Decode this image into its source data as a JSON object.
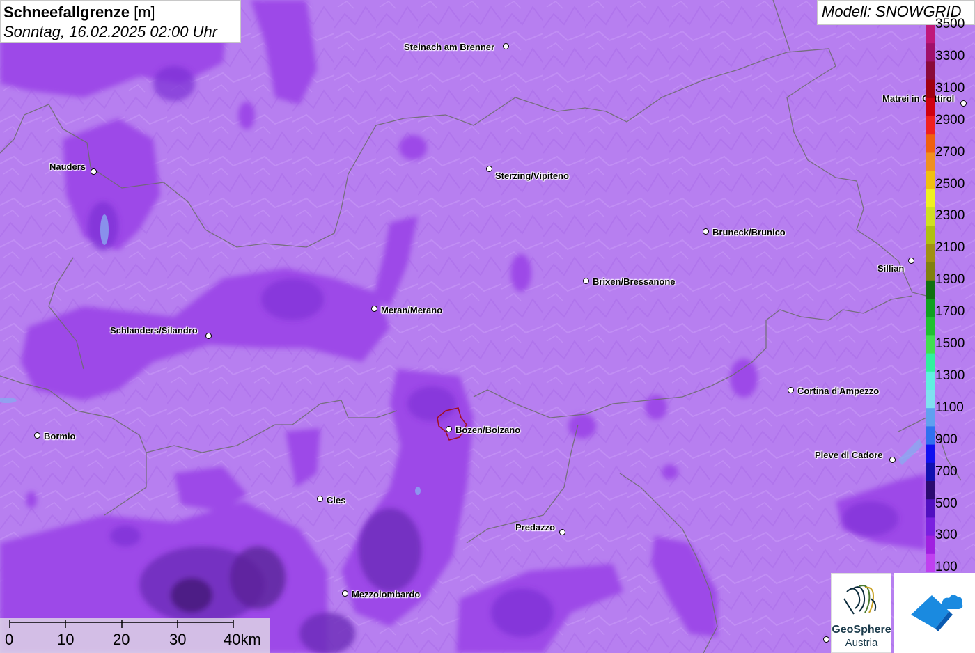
{
  "title": {
    "main": "Schneefallgrenze",
    "unit": "[m]",
    "datetime": "Sonntag, 16.02.2025 02:00 Uhr"
  },
  "model_label": "Modell: SNOWGRID",
  "cities": [
    {
      "name": "Steinach am Brenner"
    },
    {
      "name": "Nauders"
    },
    {
      "name": "Sterzing/Vipiteno"
    },
    {
      "name": "Bruneck/Brunico"
    },
    {
      "name": "Brixen/Bressanone"
    },
    {
      "name": "Meran/Merano"
    },
    {
      "name": "Schlanders/Silandro"
    },
    {
      "name": "Matrei in Osttirol"
    },
    {
      "name": "Sillian"
    },
    {
      "name": "Cortina d'Ampezzo"
    },
    {
      "name": "Bozen/Bolzano"
    },
    {
      "name": "Pieve di Cadore"
    },
    {
      "name": "Bormio"
    },
    {
      "name": "Cles"
    },
    {
      "name": "Predazzo"
    },
    {
      "name": "Mezzolombardo"
    }
  ],
  "legend": {
    "ticks": [
      "3500",
      "3300",
      "3100",
      "2900",
      "2700",
      "2500",
      "2300",
      "2100",
      "1900",
      "1700",
      "1500",
      "1300",
      "1100",
      "900",
      "700",
      "500",
      "300",
      "100"
    ],
    "colors": [
      "#c0187a",
      "#a0106a",
      "#8a0a3a",
      "#a00010",
      "#d00010",
      "#f02020",
      "#f06010",
      "#f09020",
      "#f0c010",
      "#f0f020",
      "#d0e020",
      "#b0c010",
      "#a09010",
      "#808010",
      "#107010",
      "#10a020",
      "#20c030",
      "#40e050",
      "#30f0a0",
      "#60f0e0",
      "#80e0f0",
      "#60a0f0",
      "#3070f0",
      "#1010f0",
      "#1010b0",
      "#2a0a70",
      "#5010c0",
      "#7a20e0",
      "#a020e0",
      "#c040f0"
    ]
  },
  "scale": {
    "labels": [
      "0",
      "10",
      "20",
      "30",
      "40km"
    ]
  },
  "logos": {
    "geosphere_line1": "GeoSphere",
    "geosphere_line2": "Austria"
  },
  "colors": {
    "background": "#b77ff0",
    "light_violet": "#bf8af3",
    "mid_violet": "#9d4ae8",
    "deep_violet": "#7a2fd4",
    "dark_violet": "#5a2498",
    "border": "#6b6b6b"
  }
}
